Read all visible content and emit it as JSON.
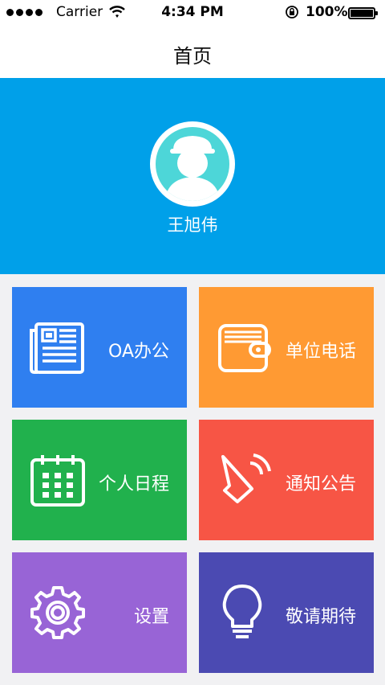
{
  "status_bar": {
    "carrier": "Carrier",
    "time": "4:34 PM",
    "battery": "100%"
  },
  "nav": {
    "title": "首页"
  },
  "profile": {
    "name": "王旭伟"
  },
  "tiles": [
    {
      "label": "OA办公",
      "icon": "newspaper-icon",
      "color": "#2f7ff0"
    },
    {
      "label": "单位电话",
      "icon": "wallet-icon",
      "color": "#ff9a33"
    },
    {
      "label": "个人日程",
      "icon": "calendar-icon",
      "color": "#21b14d"
    },
    {
      "label": "通知公告",
      "icon": "speaker-icon",
      "color": "#f75545"
    },
    {
      "label": "设置",
      "icon": "gear-icon",
      "color": "#9864d6"
    },
    {
      "label": "敬请期待",
      "icon": "lightbulb-icon",
      "color": "#4b4ab2"
    }
  ],
  "colors": {
    "header": "#00a0e9",
    "background": "#f1f1f3"
  }
}
